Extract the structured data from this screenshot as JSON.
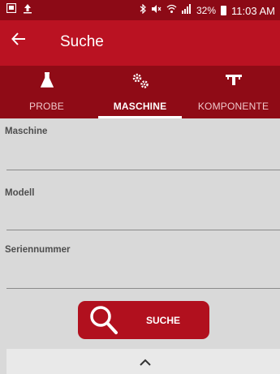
{
  "status_bar": {
    "battery": "32%",
    "time": "11:03 AM"
  },
  "app_bar": {
    "back_icon": "arrow-left-icon",
    "title": "Suche"
  },
  "tabs": [
    {
      "label": "PROBE",
      "icon": "flask-icon",
      "active": false
    },
    {
      "label": "MASCHINE",
      "icon": "gears-icon",
      "active": true
    },
    {
      "label": "KOMPONENTE",
      "icon": "component-icon",
      "active": false
    }
  ],
  "form": {
    "fields": [
      {
        "label": "Maschine",
        "value": ""
      },
      {
        "label": "Modell",
        "value": ""
      },
      {
        "label": "Seriennummer",
        "value": ""
      }
    ]
  },
  "search_button": {
    "label": "SUCHE",
    "icon": "search-icon"
  },
  "bottom_sheet": {
    "icon": "chevron-up-icon"
  },
  "colors": {
    "status_bar": "#8c0a16",
    "app_bar": "#ba1222",
    "tab_bar": "#8f0b16",
    "button": "#b1101e",
    "background": "#d9d9d9"
  }
}
